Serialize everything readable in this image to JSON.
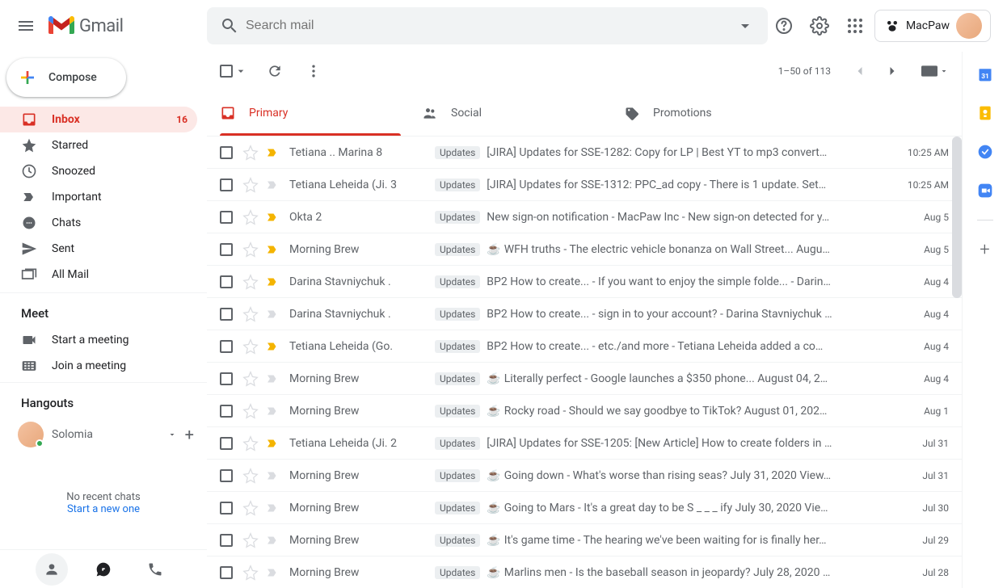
{
  "header": {
    "logo_text": "Gmail",
    "search_placeholder": "Search mail",
    "org_name": "MacPaw"
  },
  "compose_label": "Compose",
  "nav": [
    {
      "label": "Inbox",
      "count": "16",
      "active": true,
      "icon": "inbox"
    },
    {
      "label": "Starred",
      "icon": "star"
    },
    {
      "label": "Snoozed",
      "icon": "clock"
    },
    {
      "label": "Important",
      "icon": "important"
    },
    {
      "label": "Chats",
      "icon": "chat"
    },
    {
      "label": "Sent",
      "icon": "sent"
    },
    {
      "label": "All Mail",
      "icon": "allmail"
    }
  ],
  "meet": {
    "header": "Meet",
    "start": "Start a meeting",
    "join": "Join a meeting"
  },
  "hangouts": {
    "header": "Hangouts",
    "user": "Solomia",
    "no_chats": "No recent chats",
    "start_new": "Start a new one"
  },
  "toolbar": {
    "page_text": "1–50 of 113"
  },
  "tabs": [
    {
      "label": "Primary",
      "active": true
    },
    {
      "label": "Social"
    },
    {
      "label": "Promotions"
    }
  ],
  "emails": [
    {
      "sender": "Tetiana .. Marina",
      "count": "8",
      "important": true,
      "tag": "Updates",
      "subject": "[JIRA] Updates for SSE-1282: Copy for LP | Best YT to mp3 convert…",
      "date": "10:25 AM"
    },
    {
      "sender": "Tetiana Leheida (Ji.",
      "count": "3",
      "important": false,
      "tag": "Updates",
      "subject": "[JIRA] Updates for SSE-1312: PPC_ad copy",
      "snippet": " - There is 1 update. Set…",
      "date": "10:25 AM"
    },
    {
      "sender": "Okta",
      "count": "2",
      "important": true,
      "tag": "Updates",
      "subject": "New sign-on notification",
      "snippet": " - MacPaw Inc - New sign-on detected for y…",
      "date": "Aug 5"
    },
    {
      "sender": "Morning Brew",
      "important": true,
      "tag": "Updates",
      "emoji": "☕",
      "subject": "WFH truths",
      "snippet": " - The electric vehicle bonanza on Wall Street... Augu…",
      "date": "Aug 5"
    },
    {
      "sender": "Darina Stavniychuk .",
      "important": true,
      "tag": "Updates",
      "subject": "BP2 How to create...",
      "snippet": " - If you want to enjoy the simple folde... - Darin…",
      "date": "Aug 4"
    },
    {
      "sender": "Darina Stavniychuk .",
      "important": false,
      "tag": "Updates",
      "subject": "BP2 How to create...",
      "snippet": " - sign in to your account? - Darina Stavniychuk …",
      "date": "Aug 4"
    },
    {
      "sender": "Tetiana Leheida (Go.",
      "important": true,
      "tag": "Updates",
      "subject": "BP2 How to create...",
      "snippet": " - etc./and more - Tetiana Leheida added a co…",
      "date": "Aug 4"
    },
    {
      "sender": "Morning Brew",
      "important": false,
      "tag": "Updates",
      "emoji": "☕",
      "subject": "Literally perfect",
      "snippet": " - Google launches a $350 phone... August 04, 2…",
      "date": "Aug 4"
    },
    {
      "sender": "Morning Brew",
      "important": false,
      "tag": "Updates",
      "emoji": "☕",
      "subject": "Rocky road",
      "snippet": " - Should we say goodbye to TikTok? August 01, 202…",
      "date": "Aug 1"
    },
    {
      "sender": "Tetiana Leheida (Ji.",
      "count": "2",
      "important": true,
      "tag": "Updates",
      "subject": "[JIRA] Updates for SSE-1205: [New Article] How to create folders in …",
      "date": "Jul 31"
    },
    {
      "sender": "Morning Brew",
      "important": false,
      "tag": "Updates",
      "emoji": "☕",
      "subject": "Going down",
      "snippet": " - What's worse than rising seas? July 31, 2020 View…",
      "date": "Jul 31"
    },
    {
      "sender": "Morning Brew",
      "important": false,
      "tag": "Updates",
      "emoji": "☕",
      "subject": "Going to Mars",
      "snippet": " - It's a great day to be S _ _ _ ify July 30, 2020 Vie…",
      "date": "Jul 30"
    },
    {
      "sender": "Morning Brew",
      "important": false,
      "tag": "Updates",
      "emoji": "☕",
      "subject": "It's game time",
      "snippet": " - The hearing we've been waiting for is finally her…",
      "date": "Jul 29"
    },
    {
      "sender": "Morning Brew",
      "important": false,
      "tag": "Updates",
      "emoji": "☕",
      "subject": "Marlins men",
      "snippet": " - Is the baseball season in jeopardy? July 28, 2020 …",
      "date": "Jul 28"
    }
  ]
}
